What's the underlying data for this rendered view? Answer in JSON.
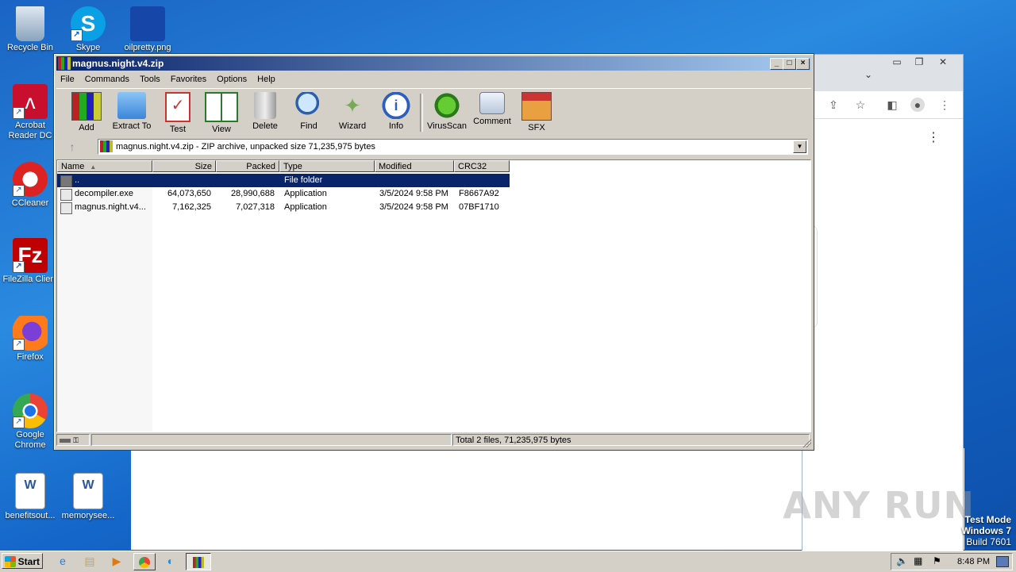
{
  "desktop": {
    "icons": [
      {
        "label": "Recycle Bin"
      },
      {
        "label": "Skype"
      },
      {
        "label": "oilpretty.png"
      },
      {
        "label": "Acrobat Reader DC"
      },
      {
        "label": "CCleaner"
      },
      {
        "label": "FileZilla Client"
      },
      {
        "label": "Firefox"
      },
      {
        "label": "Google Chrome"
      },
      {
        "label": "benefitsout..."
      },
      {
        "label": "memorysee..."
      }
    ]
  },
  "winrar": {
    "title": "magnus.night.v4.zip",
    "menu": [
      "File",
      "Commands",
      "Tools",
      "Favorites",
      "Options",
      "Help"
    ],
    "toolbar": [
      {
        "label": "Add",
        "icon": "books-icon"
      },
      {
        "label": "Extract To",
        "icon": "folder-icon"
      },
      {
        "label": "Test",
        "icon": "checklist-icon"
      },
      {
        "label": "View",
        "icon": "book-icon"
      },
      {
        "label": "Delete",
        "icon": "trash-icon"
      },
      {
        "label": "Find",
        "icon": "magnifier-icon"
      },
      {
        "label": "Wizard",
        "icon": "wand-icon"
      },
      {
        "label": "Info",
        "icon": "info-icon"
      },
      {
        "label": "VirusScan",
        "icon": "bug-icon"
      },
      {
        "label": "Comment",
        "icon": "comment-icon"
      },
      {
        "label": "SFX",
        "icon": "sfx-icon"
      }
    ],
    "address": "magnus.night.v4.zip - ZIP archive, unpacked size 71,235,975 bytes",
    "columns": [
      "Name",
      "Size",
      "Packed",
      "Type",
      "Modified",
      "CRC32"
    ],
    "rows": [
      {
        "name": "..",
        "size": "",
        "packed": "",
        "type": "File folder",
        "modified": "",
        "crc": ""
      },
      {
        "name": "decompiler.exe",
        "size": "64,073,650",
        "packed": "28,990,688",
        "type": "Application",
        "modified": "3/5/2024 9:58 PM",
        "crc": "F8667A92"
      },
      {
        "name": "magnus.night.v4...",
        "size": "7,162,325",
        "packed": "7,027,318",
        "type": "Application",
        "modified": "3/5/2024 9:58 PM",
        "crc": "07BF1710"
      }
    ],
    "status": "Total 2 files, 71,235,975 bytes"
  },
  "taskbar": {
    "start": "Start",
    "clock": "8:48 PM"
  },
  "overlay": {
    "watermark": "ANY RUN",
    "test_mode_1": "Test Mode",
    "test_mode_2": "Windows 7",
    "test_mode_3": "Build 7601"
  }
}
